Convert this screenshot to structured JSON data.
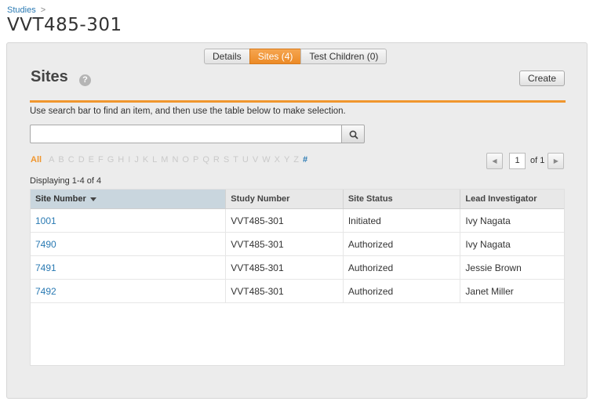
{
  "breadcrumb": {
    "link": "Studies",
    "separator": ">"
  },
  "page_title": "VVT485-301",
  "tabs": [
    {
      "label": "Details",
      "active": false
    },
    {
      "label": "Sites (4)",
      "active": true
    },
    {
      "label": "Test Children (0)",
      "active": false
    }
  ],
  "section": {
    "title": "Sites",
    "help_icon": "question-icon",
    "create_label": "Create"
  },
  "instructions": "Use search bar to find an item, and then use the table below to make selection.",
  "search": {
    "placeholder": "",
    "button_icon": "search-icon"
  },
  "alphabet": {
    "all_label": "All",
    "letters": [
      "A",
      "B",
      "C",
      "D",
      "E",
      "F",
      "G",
      "H",
      "I",
      "J",
      "K",
      "L",
      "M",
      "N",
      "O",
      "P",
      "Q",
      "R",
      "S",
      "T",
      "U",
      "V",
      "W",
      "X",
      "Y",
      "Z"
    ],
    "hash_label": "#"
  },
  "pager": {
    "current_page": "1",
    "of_label": "of 1",
    "prev_icon": "chevron-left-icon",
    "next_icon": "chevron-right-icon"
  },
  "displaying": "Displaying 1-4 of 4",
  "table": {
    "headers": [
      "Site Number",
      "Study Number",
      "Site Status",
      "Lead Investigator"
    ],
    "sorted_column": "Site Number",
    "rows": [
      [
        "1001",
        "VVT485-301",
        "Initiated",
        "Ivy Nagata"
      ],
      [
        "7490",
        "VVT485-301",
        "Authorized",
        "Ivy Nagata"
      ],
      [
        "7491",
        "VVT485-301",
        "Authorized",
        "Jessie Brown"
      ],
      [
        "7492",
        "VVT485-301",
        "Authorized",
        "Janet Miller"
      ]
    ]
  },
  "colors": {
    "accent": "#f0962e",
    "link": "#2a7ab3"
  }
}
